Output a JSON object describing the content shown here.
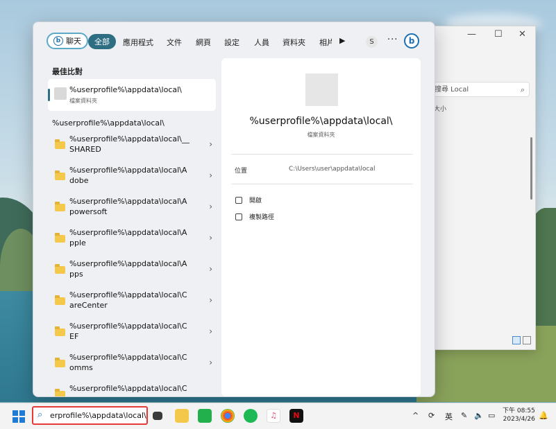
{
  "explorer": {
    "search_placeholder": "搜尋 Local",
    "column_header": "大小",
    "minimize": "—",
    "maximize": "☐",
    "close": "✕"
  },
  "topbar": {
    "chat_label": "聊天",
    "tabs": [
      "全部",
      "應用程式",
      "文件",
      "網頁",
      "設定",
      "人員",
      "資料夾",
      "相片"
    ],
    "avatar_initial": "S",
    "more": "···"
  },
  "left": {
    "best_match_title": "最佳比對",
    "best_match": {
      "name": "%userprofile%\\appdata\\local\\",
      "type": "檔案資料夾"
    },
    "path_header": "%userprofile%\\appdata\\local\\",
    "items": [
      {
        "line1": "%userprofile%\\appdata\\local\\__",
        "line2": "SHARED"
      },
      {
        "line1": "%userprofile%\\appdata\\local\\A",
        "line2": "dobe"
      },
      {
        "line1": "%userprofile%\\appdata\\local\\A",
        "line2": "powersoft"
      },
      {
        "line1": "%userprofile%\\appdata\\local\\A",
        "line2": "pple"
      },
      {
        "line1": "%userprofile%\\appdata\\local\\A",
        "line2": "pps"
      },
      {
        "line1": "%userprofile%\\appdata\\local\\C",
        "line2": "areCenter"
      },
      {
        "line1": "%userprofile%\\appdata\\local\\C",
        "line2": "EF"
      },
      {
        "line1": "%userprofile%\\appdata\\local\\C",
        "line2": "omms"
      },
      {
        "line1": "%userprofile%\\appdata\\local\\C",
        "line2": ""
      }
    ]
  },
  "preview": {
    "title": "%userprofile%\\appdata\\local\\",
    "subtitle": "檔案資料夾",
    "location_label": "位置",
    "location_value": "C:\\Users\\user\\appdata\\local",
    "actions": [
      "開啟",
      "複製路徑"
    ]
  },
  "taskbar": {
    "search_text": "erprofile%\\appdata\\local\\",
    "ime": "英",
    "time": "下午 08:55",
    "date": "2023/4/26"
  },
  "colors": {
    "accent": "#2e6e82",
    "highlight_border": "#e53935",
    "folder": "#f4c84a"
  }
}
